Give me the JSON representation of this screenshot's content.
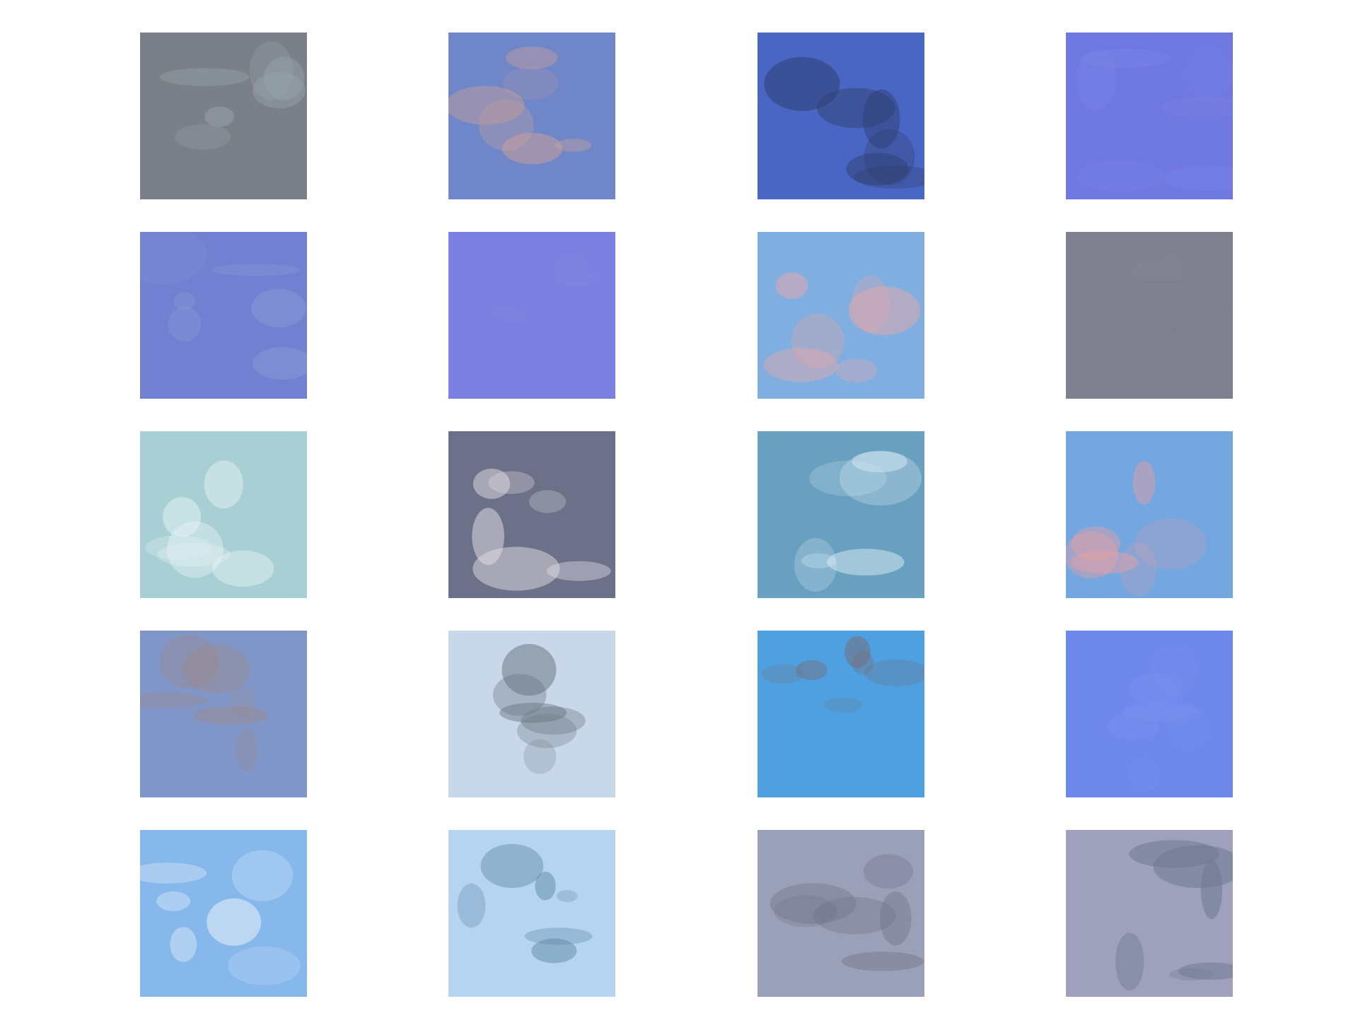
{
  "grid": {
    "rows": 5,
    "columns": 4,
    "tiles": [
      {
        "id": "r1c1",
        "dominant_color": "#7b8088",
        "accent_color": "#9aa8b0"
      },
      {
        "id": "r1c2",
        "dominant_color": "#6f86c8",
        "accent_color": "#c8a09a"
      },
      {
        "id": "r1c3",
        "dominant_color": "#4a66c4",
        "accent_color": "#2f3f70"
      },
      {
        "id": "r1c4",
        "dominant_color": "#6f78e0",
        "accent_color": "#7c86e6"
      },
      {
        "id": "r2c1",
        "dominant_color": "#7180d0",
        "accent_color": "#8c9ad8"
      },
      {
        "id": "r2c2",
        "dominant_color": "#7a7fe0",
        "accent_color": "#8287e4"
      },
      {
        "id": "r2c3",
        "dominant_color": "#80aee0",
        "accent_color": "#e8a8a8"
      },
      {
        "id": "r2c4",
        "dominant_color": "#7e7f8f",
        "accent_color": "#838493"
      },
      {
        "id": "r3c1",
        "dominant_color": "#a8cfd4",
        "accent_color": "#e8f4f6"
      },
      {
        "id": "r3c2",
        "dominant_color": "#6c7088",
        "accent_color": "#e4e0e6"
      },
      {
        "id": "r3c3",
        "dominant_color": "#6aa0bf",
        "accent_color": "#d9ecf6"
      },
      {
        "id": "r3c4",
        "dominant_color": "#74a6e0",
        "accent_color": "#e1a0a6"
      },
      {
        "id": "r4c1",
        "dominant_color": "#8196c8",
        "accent_color": "#a08880"
      },
      {
        "id": "r4c2",
        "dominant_color": "#c8d8ea",
        "accent_color": "#6a7480"
      },
      {
        "id": "r4c3",
        "dominant_color": "#4ea0e0",
        "accent_color": "#7a6a70"
      },
      {
        "id": "r4c4",
        "dominant_color": "#6e88ec",
        "accent_color": "#7890ee"
      },
      {
        "id": "r5c1",
        "dominant_color": "#86b8ec",
        "accent_color": "#f4f6fa"
      },
      {
        "id": "r5c2",
        "dominant_color": "#b4d4f2",
        "accent_color": "#5c84a0"
      },
      {
        "id": "r5c3",
        "dominant_color": "#9aa0b8",
        "accent_color": "#6a6c80"
      },
      {
        "id": "r5c4",
        "dominant_color": "#9ea0bc",
        "accent_color": "#6e7890"
      }
    ]
  }
}
